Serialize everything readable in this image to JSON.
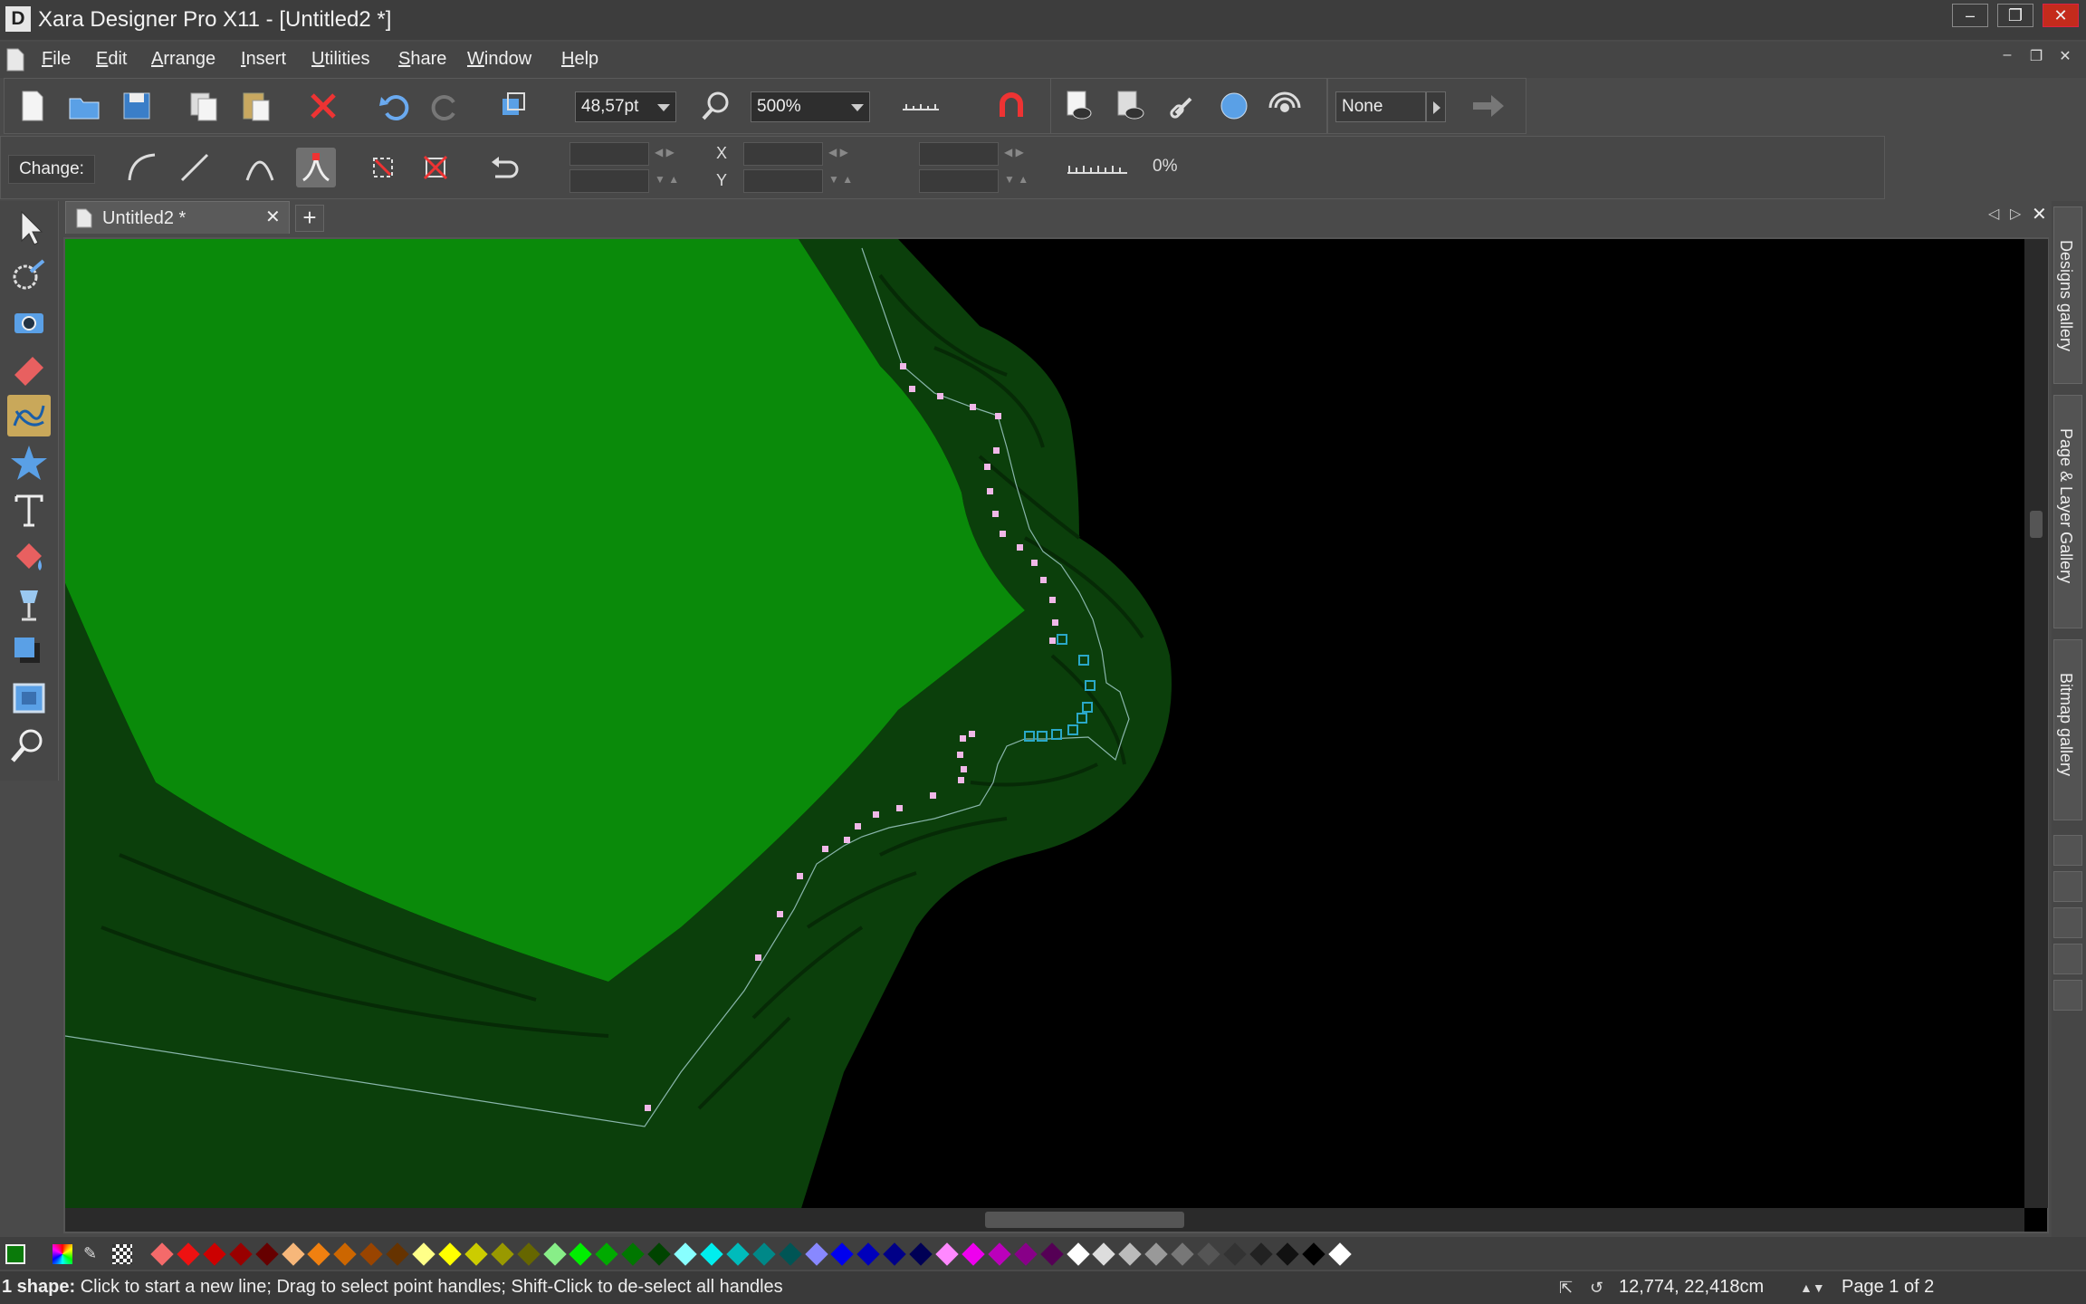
{
  "window": {
    "app_logo": "D",
    "title": "Xara Designer Pro X11 - [Untitled2 *]",
    "controls": [
      "minimize",
      "restore",
      "close"
    ]
  },
  "menu": [
    "File",
    "Edit",
    "Arrange",
    "Insert",
    "Utilities",
    "Share",
    "Window",
    "Help"
  ],
  "toolbar_main": {
    "font_size_value": "48,57pt",
    "zoom_value": "500%",
    "quality_value": "None"
  },
  "toolbar_shape": {
    "change_label": "Change:",
    "x_label": "X",
    "y_label": "Y",
    "percent_value": "0%"
  },
  "doc_tab": {
    "label": "Untitled2 *"
  },
  "galleries": [
    "Designs gallery",
    "Page & Layer Gallery",
    "Bitmap gallery"
  ],
  "palette": {
    "current_fill": "#0a7a0a",
    "colors": [
      "#f46a6a",
      "#ee1111",
      "#cc0000",
      "#990000",
      "#660000",
      "#f7b77a",
      "#f08010",
      "#cc6600",
      "#994400",
      "#663300",
      "#ffff88",
      "#ffff00",
      "#cccc00",
      "#999900",
      "#666600",
      "#88ee88",
      "#00ee00",
      "#00aa00",
      "#007700",
      "#004400",
      "#88ffff",
      "#00eeee",
      "#00bbbb",
      "#008888",
      "#005555",
      "#8888ff",
      "#0000ee",
      "#0000bb",
      "#000088",
      "#000055",
      "#ff88ff",
      "#ee00ee",
      "#bb00bb",
      "#880088",
      "#550055",
      "#ffffff",
      "#dddddd",
      "#bbbbbb",
      "#999999",
      "#777777",
      "#555555",
      "#333333",
      "#222222",
      "#111111",
      "#000000",
      "#ffffff"
    ]
  },
  "status": {
    "shape_count": "1 shape:",
    "hint": "Click to start a new line; Drag to select point handles; Shift-Click to de-select all handles",
    "coords": "12,774, 22,418cm",
    "page": "Page 1 of 2"
  },
  "colors": {
    "canvas_bg": "#000000",
    "shape_fill": "#0a8a0a",
    "edge_dark": "#0b3f0b",
    "handle_pink": "#f0b8e8",
    "handle_cyan": "#2aa8c8",
    "active_tool": "#c9a85a"
  }
}
